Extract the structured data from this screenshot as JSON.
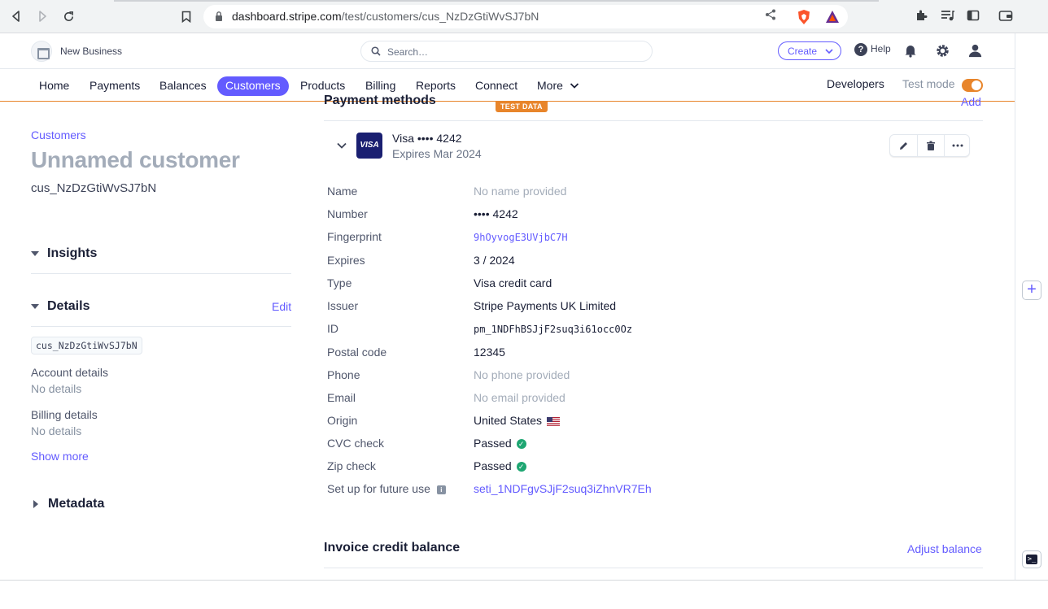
{
  "browser": {
    "url_host": "dashboard.stripe.com",
    "url_path": "/test/customers/cus_NzDzGtiWvSJ7bN"
  },
  "header": {
    "business_name": "New Business",
    "search_placeholder": "Search…",
    "create_label": "Create",
    "help_label": "Help"
  },
  "nav": {
    "items": [
      {
        "label": "Home"
      },
      {
        "label": "Payments"
      },
      {
        "label": "Balances"
      },
      {
        "label": "Customers",
        "active": true
      },
      {
        "label": "Products"
      },
      {
        "label": "Billing"
      },
      {
        "label": "Reports"
      },
      {
        "label": "Connect"
      },
      {
        "label": "More"
      }
    ],
    "developers_label": "Developers",
    "test_mode_label": "Test mode",
    "test_mode_on": true
  },
  "customer": {
    "breadcrumb": "Customers",
    "title": "Unnamed customer",
    "id": "cus_NzDzGtiWvSJ7bN"
  },
  "left": {
    "insights_title": "Insights",
    "details_title": "Details",
    "edit_label": "Edit",
    "id_pill": "cus_NzDzGtiWvSJ7bN",
    "account_details_label": "Account details",
    "account_details_value": "No details",
    "billing_details_label": "Billing details",
    "billing_details_value": "No details",
    "show_more_label": "Show more",
    "metadata_title": "Metadata"
  },
  "payment_methods": {
    "title": "Payment methods",
    "add_label": "Add",
    "test_data_badge": "TEST DATA",
    "card_brand_logo": "VISA",
    "card_summary": "Visa •••• 4242",
    "card_expiry": "Expires Mar 2024",
    "rows": [
      {
        "label": "Name",
        "value": "No name provided",
        "style": "muted"
      },
      {
        "label": "Number",
        "value": "•••• 4242",
        "style": "plain"
      },
      {
        "label": "Fingerprint",
        "value": "9hOyvogE3UVjbC7H",
        "style": "mono-link"
      },
      {
        "label": "Expires",
        "value": "3 / 2024",
        "style": "plain"
      },
      {
        "label": "Type",
        "value": "Visa credit card",
        "style": "plain"
      },
      {
        "label": "Issuer",
        "value": "Stripe Payments UK Limited",
        "style": "plain"
      },
      {
        "label": "ID",
        "value": "pm_1NDFhBSJjF2suq3i61occ0Oz",
        "style": "mono"
      },
      {
        "label": "Postal code",
        "value": "12345",
        "style": "plain"
      },
      {
        "label": "Phone",
        "value": "No phone provided",
        "style": "muted"
      },
      {
        "label": "Email",
        "value": "No email provided",
        "style": "muted"
      },
      {
        "label": "Origin",
        "value": "United States",
        "style": "flag"
      },
      {
        "label": "CVC check",
        "value": "Passed",
        "style": "check"
      },
      {
        "label": "Zip check",
        "value": "Passed",
        "style": "check"
      },
      {
        "label": "Set up for future use",
        "value": "seti_1NDFgvSJjF2suq3iZhnVR7Eh",
        "style": "link"
      }
    ]
  },
  "invoice_credit": {
    "title": "Invoice credit balance",
    "adjust_label": "Adjust balance"
  },
  "colors": {
    "accent": "#635bff",
    "test_mode": "#e8852b",
    "success": "#1ea672"
  }
}
